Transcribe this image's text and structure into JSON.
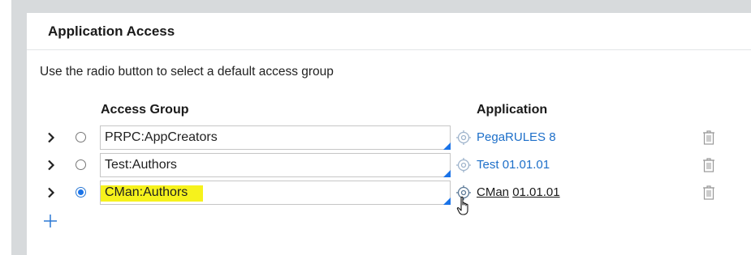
{
  "panel": {
    "title": "Application Access",
    "instructions": "Use the radio button to select a default access group"
  },
  "columns": {
    "access_group": "Access Group",
    "application": "Application"
  },
  "rows": [
    {
      "access_group": "PRPC:AppCreators",
      "app_name": "PegaRULES",
      "app_version": "8",
      "default": false,
      "highlighted": false
    },
    {
      "access_group": "Test:Authors",
      "app_name": "Test",
      "app_version": "01.01.01",
      "default": false,
      "highlighted": false
    },
    {
      "access_group": "CMan:Authors",
      "app_name": "CMan",
      "app_version": "01.01.01",
      "default": true,
      "highlighted": true
    }
  ],
  "icons": {
    "expand": "chevron-right-icon",
    "target": "target-icon",
    "delete": "trash-icon",
    "add": "plus-icon"
  },
  "colors": {
    "link": "#1d6fc9",
    "accent": "#1a73e8",
    "highlight": "#f6f21c",
    "background": "#d7dadc"
  }
}
